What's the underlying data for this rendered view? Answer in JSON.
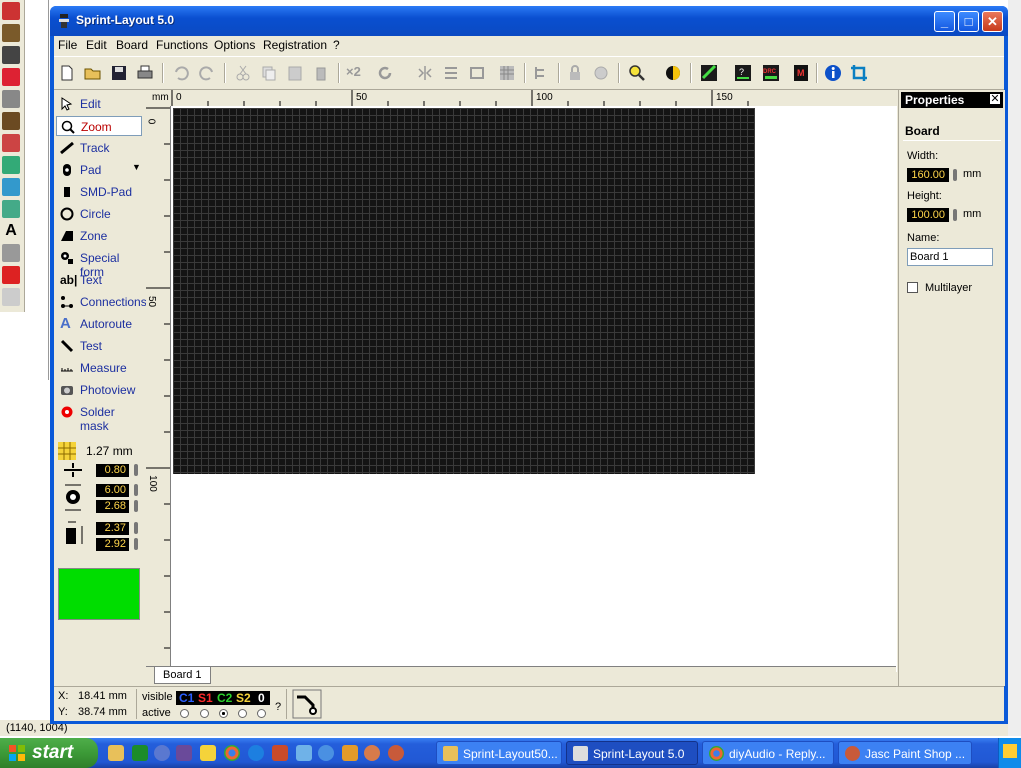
{
  "background_app": {
    "status_coords": "(1140, 1004)"
  },
  "window": {
    "title": "Sprint-Layout 5.0",
    "controls": {
      "minimize": "_",
      "maximize": "□",
      "close": "✕"
    }
  },
  "menu": [
    "File",
    "Edit",
    "Board",
    "Functions",
    "Options",
    "Registration",
    "?"
  ],
  "toolbar": {
    "x2_label": "×2",
    "accent_color": "#0a59d8"
  },
  "tools": [
    {
      "label": "Edit",
      "icon": "pointer-icon"
    },
    {
      "label": "Zoom",
      "icon": "magnifier-icon"
    },
    {
      "label": "Track",
      "icon": "track-icon"
    },
    {
      "label": "Pad",
      "icon": "pad-icon"
    },
    {
      "label": "SMD-Pad",
      "icon": "smd-pad-icon"
    },
    {
      "label": "Circle",
      "icon": "circle-icon"
    },
    {
      "label": "Zone",
      "icon": "zone-icon"
    },
    {
      "label": "Special form",
      "icon": "special-form-icon"
    },
    {
      "label": "Text",
      "icon": "text-icon"
    },
    {
      "label": "Connections",
      "icon": "connections-icon"
    },
    {
      "label": "Autoroute",
      "icon": "autoroute-icon"
    },
    {
      "label": "Test",
      "icon": "test-icon"
    },
    {
      "label": "Measure",
      "icon": "measure-icon"
    },
    {
      "label": "Photoview",
      "icon": "photoview-icon"
    },
    {
      "label": "Solder mask",
      "icon": "solder-mask-icon"
    }
  ],
  "grid": {
    "label": "1.27 mm"
  },
  "params": {
    "track_width": "0.80",
    "pad_outer": "6.00",
    "pad_inner": "2.68",
    "smd_w": "2.37",
    "smd_h": "2.92"
  },
  "current_color": "#00dd00",
  "ruler": {
    "unit": "mm",
    "top_ticks": [
      "0",
      "50",
      "100",
      "150"
    ],
    "left_ticks": [
      "0",
      "50",
      "100"
    ]
  },
  "board_tab": "Board 1",
  "properties": {
    "title": "Properties",
    "close": "✕",
    "section": "Board",
    "width_label": "Width:",
    "width_value": "160.00",
    "height_label": "Height:",
    "height_value": "100.00",
    "unit": "mm",
    "name_label": "Name:",
    "name_value": "Board 1",
    "multilayer_label": "Multilayer"
  },
  "status": {
    "x_label": "X:",
    "x_value": "18.41 mm",
    "y_label": "Y:",
    "y_value": "38.74 mm",
    "visible_label": "visible",
    "active_label": "active",
    "layers": [
      "C1",
      "S1",
      "C2",
      "S2",
      "0"
    ],
    "help": "?"
  },
  "taskbar": {
    "start": "start",
    "tasks": [
      "Sprint-Layout50...",
      "Sprint-Layout 5.0",
      "diyAudio - Reply...",
      "Jasc Paint Shop ..."
    ]
  }
}
